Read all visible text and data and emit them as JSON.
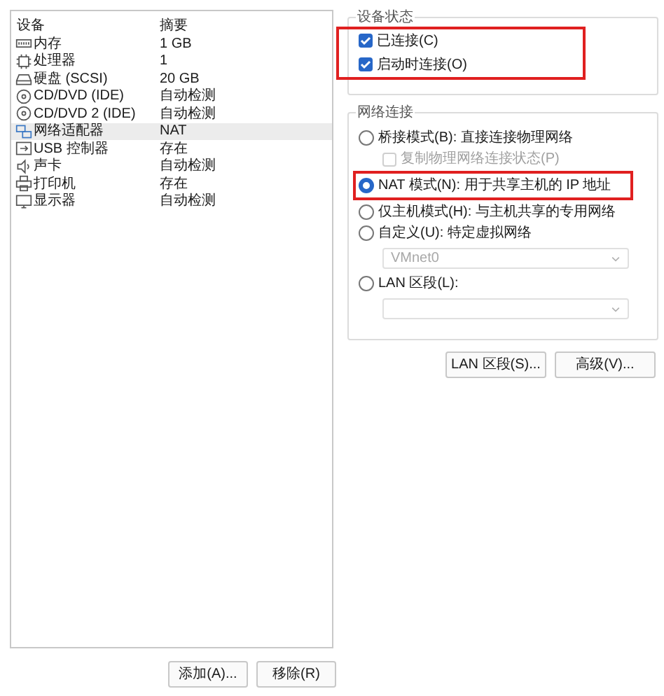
{
  "device_list": {
    "columns": [
      "设备",
      "摘要"
    ],
    "rows": [
      {
        "device": "内存",
        "summary": "1 GB",
        "selected": false
      },
      {
        "device": "处理器",
        "summary": "1",
        "selected": false
      },
      {
        "device": "硬盘 (SCSI)",
        "summary": "20 GB",
        "selected": false
      },
      {
        "device": "CD/DVD (IDE)",
        "summary": "自动检测",
        "selected": false
      },
      {
        "device": "CD/DVD 2 (IDE)",
        "summary": "自动检测",
        "selected": false
      },
      {
        "device": "网络适配器",
        "summary": "NAT",
        "selected": true
      },
      {
        "device": "USB 控制器",
        "summary": "存在",
        "selected": false
      },
      {
        "device": "声卡",
        "summary": "自动检测",
        "selected": false
      },
      {
        "device": "打印机",
        "summary": "存在",
        "selected": false
      },
      {
        "device": "显示器",
        "summary": "自动检测",
        "selected": false
      }
    ]
  },
  "list_buttons": [
    "添加(A)...",
    "移除(R)"
  ],
  "device_status": {
    "title": "设备状态",
    "options": [
      {
        "label": "已连接(C)",
        "checked": true
      },
      {
        "label": "启动时连接(O)",
        "checked": true
      }
    ]
  },
  "network_connection": {
    "title": "网络连接",
    "items": [
      {
        "kind": "radio",
        "label": "桥接模式(B): 直接连接物理网络",
        "selected": false
      },
      {
        "kind": "checkbox",
        "label": "复制物理网络连接状态(P)",
        "checked": false,
        "disabled": true
      },
      {
        "kind": "radio",
        "label": "NAT 模式(N): 用于共享主机的 IP 地址",
        "selected": true
      },
      {
        "kind": "radio",
        "label": "仅主机模式(H): 与主机共享的专用网络",
        "selected": false
      },
      {
        "kind": "radio",
        "label": "自定义(U): 特定虚拟网络",
        "selected": false
      },
      {
        "kind": "dropdown",
        "value": "VMnet0",
        "disabled": true
      },
      {
        "kind": "radio",
        "label": "LAN 区段(L):",
        "selected": false
      },
      {
        "kind": "dropdown",
        "disabled": true
      }
    ]
  },
  "panel_buttons": [
    "LAN 区段(S)...",
    "高级(V)..."
  ]
}
